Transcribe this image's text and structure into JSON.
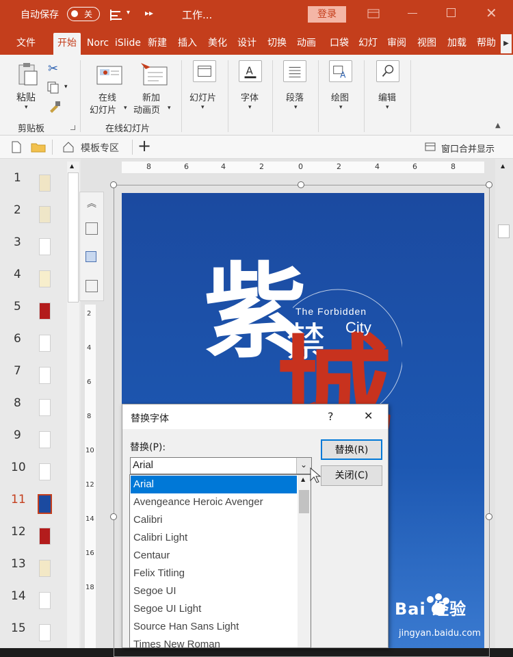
{
  "titlebar": {
    "autosave_label": "自动保存",
    "autosave_state": "关",
    "doc_title": "工作...",
    "login_label": "登录"
  },
  "tabs": [
    "文件",
    "开始",
    "Norc",
    "iSlide",
    "新建",
    "插入",
    "美化",
    "设计",
    "切换",
    "动画",
    "口袋",
    "幻灯",
    "审阅",
    "视图",
    "加载",
    "帮助"
  ],
  "ribbon": {
    "paste_label": "粘贴",
    "clipboard_group": "剪贴板",
    "online_slide_label_1": "在线",
    "online_slide_label_2": "幻灯片",
    "new_anim_label_1": "新加",
    "new_anim_label_2": "动画页",
    "online_group": "在线幻灯片",
    "slides_label": "幻灯片",
    "font_label": "字体",
    "paragraph_label": "段落",
    "drawing_label": "绘图",
    "editing_label": "编辑"
  },
  "docbar": {
    "template_label": "模板专区",
    "window_merge_label": "窗口合并显示"
  },
  "slides": {
    "numbers": [
      "1",
      "2",
      "3",
      "4",
      "5",
      "6",
      "7",
      "8",
      "9",
      "10",
      "11",
      "12",
      "13",
      "14",
      "15"
    ],
    "selected": "11"
  },
  "ruler_labels": [
    "8",
    "6",
    "4",
    "2",
    "0",
    "2",
    "4",
    "6",
    "8"
  ],
  "ruler_v_labels": [
    "2",
    "4",
    "6",
    "8",
    "10",
    "12",
    "14",
    "16",
    "18"
  ],
  "slide_content": {
    "title_char_1": "紫",
    "title_char_2": "禁",
    "title_char_3": "城",
    "subtitle_1": "The Forbidden",
    "subtitle_2": "City"
  },
  "dialog": {
    "title": "替换字体",
    "help": "?",
    "close_x": "✕",
    "replace_label": "替换(P):",
    "current_value": "Arial",
    "replace_button": "替换(R)",
    "close_button": "关闭(C)",
    "font_options": [
      "Arial",
      "Avengeance Heroic Avenger",
      "Calibri",
      "Calibri Light",
      "Centaur",
      "Felix Titling",
      "Segoe UI",
      "Segoe UI Light",
      "Source Han Sans Light",
      "Times New Roman"
    ],
    "selected_option": "Arial"
  },
  "watermark": {
    "brand": "Bai 经验",
    "url": "jingyan.baidu.com"
  },
  "colors": {
    "accent": "#c43e1c",
    "slide_bg": "#1b4aa0",
    "selection": "#0078d7"
  }
}
